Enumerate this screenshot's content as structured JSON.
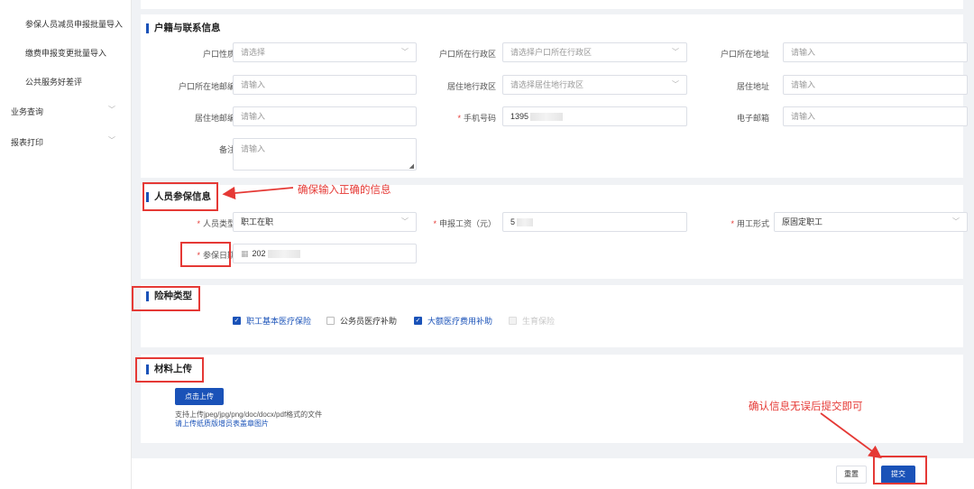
{
  "sidebar": {
    "sub_items": [
      {
        "label": "参保人员减员申报批量导入"
      },
      {
        "label": "缴费申报变更批量导入"
      },
      {
        "label": "公共服务好差评"
      }
    ],
    "top_items": [
      {
        "label": "业务查询"
      },
      {
        "label": "报表打印"
      }
    ]
  },
  "household": {
    "title": "户籍与联系信息",
    "hukou_type": {
      "label": "户口性质",
      "placeholder": "请选择"
    },
    "hukou_region": {
      "label": "户口所在行政区",
      "placeholder": "请选择户口所在行政区"
    },
    "hukou_address": {
      "label": "户口所在地址",
      "placeholder": "请输入"
    },
    "hukou_postcode": {
      "label": "户口所在地邮编",
      "placeholder": "请输入"
    },
    "residence_region": {
      "label": "居住地行政区",
      "placeholder": "请选择居住地行政区"
    },
    "residence_address": {
      "label": "居住地址",
      "placeholder": "请输入"
    },
    "residence_postcode": {
      "label": "居住地邮编",
      "placeholder": "请输入"
    },
    "phone": {
      "label": "手机号码",
      "value": "1395"
    },
    "email": {
      "label": "电子邮箱",
      "placeholder": "请输入"
    },
    "remark": {
      "label": "备注",
      "placeholder": "请输入"
    }
  },
  "insured": {
    "title": "人员参保信息",
    "person_type": {
      "label": "人员类型",
      "value": "职工在职"
    },
    "wage": {
      "label": "申报工资（元）",
      "value": "5"
    },
    "employment_form": {
      "label": "用工形式",
      "value": "原固定职工"
    },
    "insured_date": {
      "label": "参保日期",
      "value": "202"
    }
  },
  "insurance": {
    "title": "险种类型",
    "options": [
      {
        "label": "职工基本医疗保险",
        "checked": true,
        "disabled": false
      },
      {
        "label": "公务员医疗补助",
        "checked": false,
        "disabled": false
      },
      {
        "label": "大额医疗费用补助",
        "checked": true,
        "disabled": false
      },
      {
        "label": "生育保险",
        "checked": false,
        "disabled": true
      }
    ]
  },
  "upload": {
    "title": "材料上传",
    "button_label": "点击上传",
    "formats_hint": "支持上传jpeg/jpg/png/doc/docx/pdf格式的文件",
    "paper_link": "请上传纸质版增员表盖章图片"
  },
  "footer": {
    "reset_label": "重置",
    "submit_label": "提交"
  },
  "annotations": {
    "ensure_correct": "确保输入正确的信息",
    "confirm_submit": "确认信息无误后提交即可"
  },
  "icons": {
    "dropdown": "chevron-down-icon",
    "calendar": "calendar-icon",
    "resize": "resize-handle-icon"
  },
  "colors": {
    "primary": "#1a52b8",
    "annotation": "#e53935"
  }
}
